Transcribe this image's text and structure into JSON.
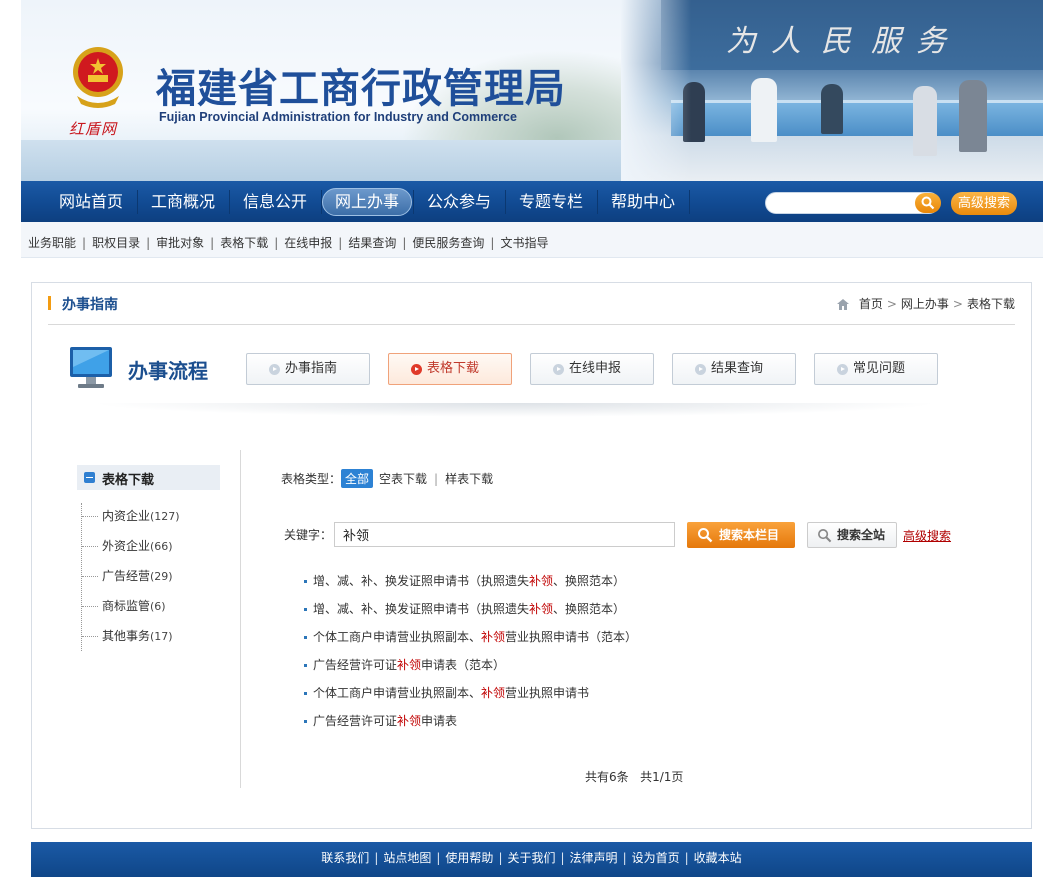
{
  "header": {
    "site_title": "福建省工商行政管理局",
    "site_subtitle": "Fujian Provincial Administration for Industry and Commerce",
    "emblem_text": "红盾网",
    "photo_calligraphy": [
      "为",
      "人",
      "民",
      "服",
      "务"
    ]
  },
  "nav": {
    "items": [
      "网站首页",
      "工商概况",
      "信息公开",
      "网上办事",
      "公众参与",
      "专题专栏",
      "帮助中心"
    ],
    "active": "网上办事",
    "search_value": "",
    "advanced_search_label": "高级搜索"
  },
  "subnav": {
    "items": [
      "业务职能",
      "职权目录",
      "审批对象",
      "表格下载",
      "在线申报",
      "结果查询",
      "便民服务查询",
      "文书指导"
    ]
  },
  "panel": {
    "title": "办事指南",
    "breadcrumb": [
      "首页",
      "网上办事",
      "表格下载"
    ]
  },
  "process": {
    "title": "办事流程",
    "steps": [
      {
        "label": "办事指南",
        "active": false
      },
      {
        "label": "表格下载",
        "active": true
      },
      {
        "label": "在线申报",
        "active": false
      },
      {
        "label": "结果查询",
        "active": false
      },
      {
        "label": "常见问题",
        "active": false
      }
    ]
  },
  "tree": {
    "title": "表格下载",
    "items": [
      {
        "label": "内资企业",
        "count": "(127)"
      },
      {
        "label": "外资企业",
        "count": "(66)"
      },
      {
        "label": "广告经营",
        "count": "(29)"
      },
      {
        "label": "商标监管",
        "count": "(6)"
      },
      {
        "label": "其他事务",
        "count": "(17)"
      }
    ]
  },
  "filters": {
    "type_label": "表格类型：",
    "types": [
      "全部",
      "空表下载",
      "样表下载"
    ],
    "active_type": "全部",
    "keyword_label": "关键字：",
    "keyword_value": "补领",
    "search_column_label": "搜索本栏目",
    "search_site_label": "搜索全站",
    "advanced_link": "高级搜索"
  },
  "results": [
    {
      "before": "增、减、补、换发证照申请书（执照遗失",
      "hl": "补领",
      "after": "、换照范本）"
    },
    {
      "before": "增、减、补、换发证照申请书（执照遗失",
      "hl": "补领",
      "after": "、换照范本）"
    },
    {
      "before": "个体工商户申请营业执照副本、",
      "hl": "补领",
      "after": "营业执照申请书（范本）"
    },
    {
      "before": "广告经营许可证",
      "hl": "补领",
      "after": "申请表（范本）"
    },
    {
      "before": "个体工商户申请营业执照副本、",
      "hl": "补领",
      "after": "营业执照申请书"
    },
    {
      "before": "广告经营许可证",
      "hl": "补领",
      "after": "申请表"
    }
  ],
  "pager": {
    "total": "共有6条",
    "pages": "共1/1页"
  },
  "footer": {
    "links": [
      "联系我们",
      "站点地图",
      "使用帮助",
      "关于我们",
      "法律声明",
      "设为首页",
      "收藏本站"
    ]
  },
  "colors": {
    "nav_blue": "#114a92",
    "title_blue": "#1f4f9a",
    "accent_orange": "#e98708",
    "highlight_red": "#c00000"
  }
}
